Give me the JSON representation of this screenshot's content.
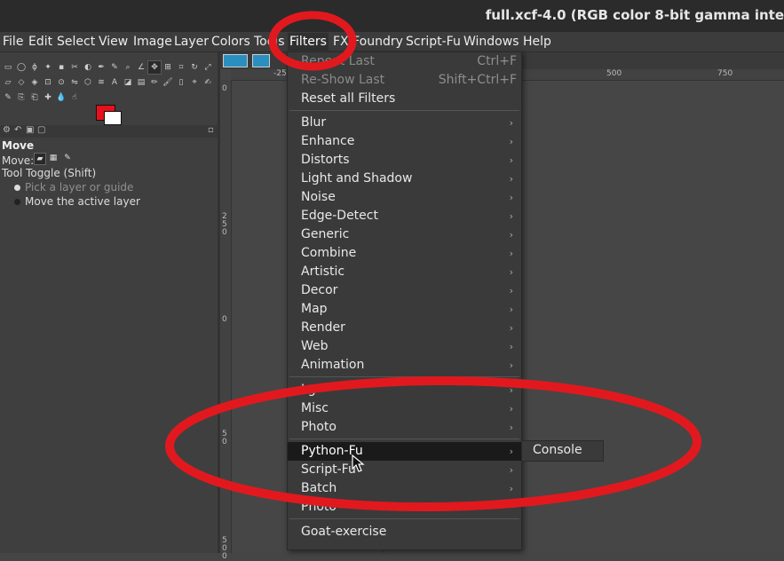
{
  "window": {
    "title": "full.xcf-4.0 (RGB color 8-bit gamma inte"
  },
  "menubar": [
    "File",
    "Edit",
    "Select",
    "View",
    "Image",
    "Layer",
    "Colors",
    "Tools",
    "Filters",
    "FX Foundry",
    "Script-Fu",
    "Windows",
    "Help"
  ],
  "active_menu": "Filters",
  "tool_options": {
    "title": "Move",
    "move_label": "Move:",
    "toggle_label": "Tool Toggle  (Shift)",
    "options": [
      "Pick a layer or guide",
      "Move the active layer"
    ]
  },
  "rulers": {
    "top": [
      "-25",
      "500",
      "750"
    ],
    "left": [
      "0",
      "250",
      "0",
      "50",
      "500"
    ]
  },
  "filters_menu": {
    "group1": [
      {
        "label": "Repeat Last",
        "shortcut": "Ctrl+F",
        "disabled": true
      },
      {
        "label": "Re-Show Last",
        "shortcut": "Shift+Ctrl+F",
        "disabled": true
      },
      {
        "label": "Reset all Filters",
        "shortcut": "",
        "disabled": false
      }
    ],
    "group2": [
      "Blur",
      "Enhance",
      "Distorts",
      "Light and Shadow",
      "Noise",
      "Edge-Detect",
      "Generic",
      "Combine",
      "Artistic",
      "Decor",
      "Map",
      "Render",
      "Web",
      "Animation"
    ],
    "group3": [
      "Lg",
      "Misc",
      "Photo"
    ],
    "group4": [
      "Python-Fu",
      "Script-Fu",
      "Batch",
      "Photo"
    ],
    "group5": [
      "Goat-exercise"
    ],
    "highlighted": "Python-Fu"
  },
  "submenu": {
    "items": [
      "Console"
    ]
  },
  "annotation_color": "#e1191e",
  "colors": {
    "foreground": "#e8101a",
    "background": "#ffffff",
    "menu_bg": "#3a3a3a",
    "highlight": "#1a1a1a"
  }
}
